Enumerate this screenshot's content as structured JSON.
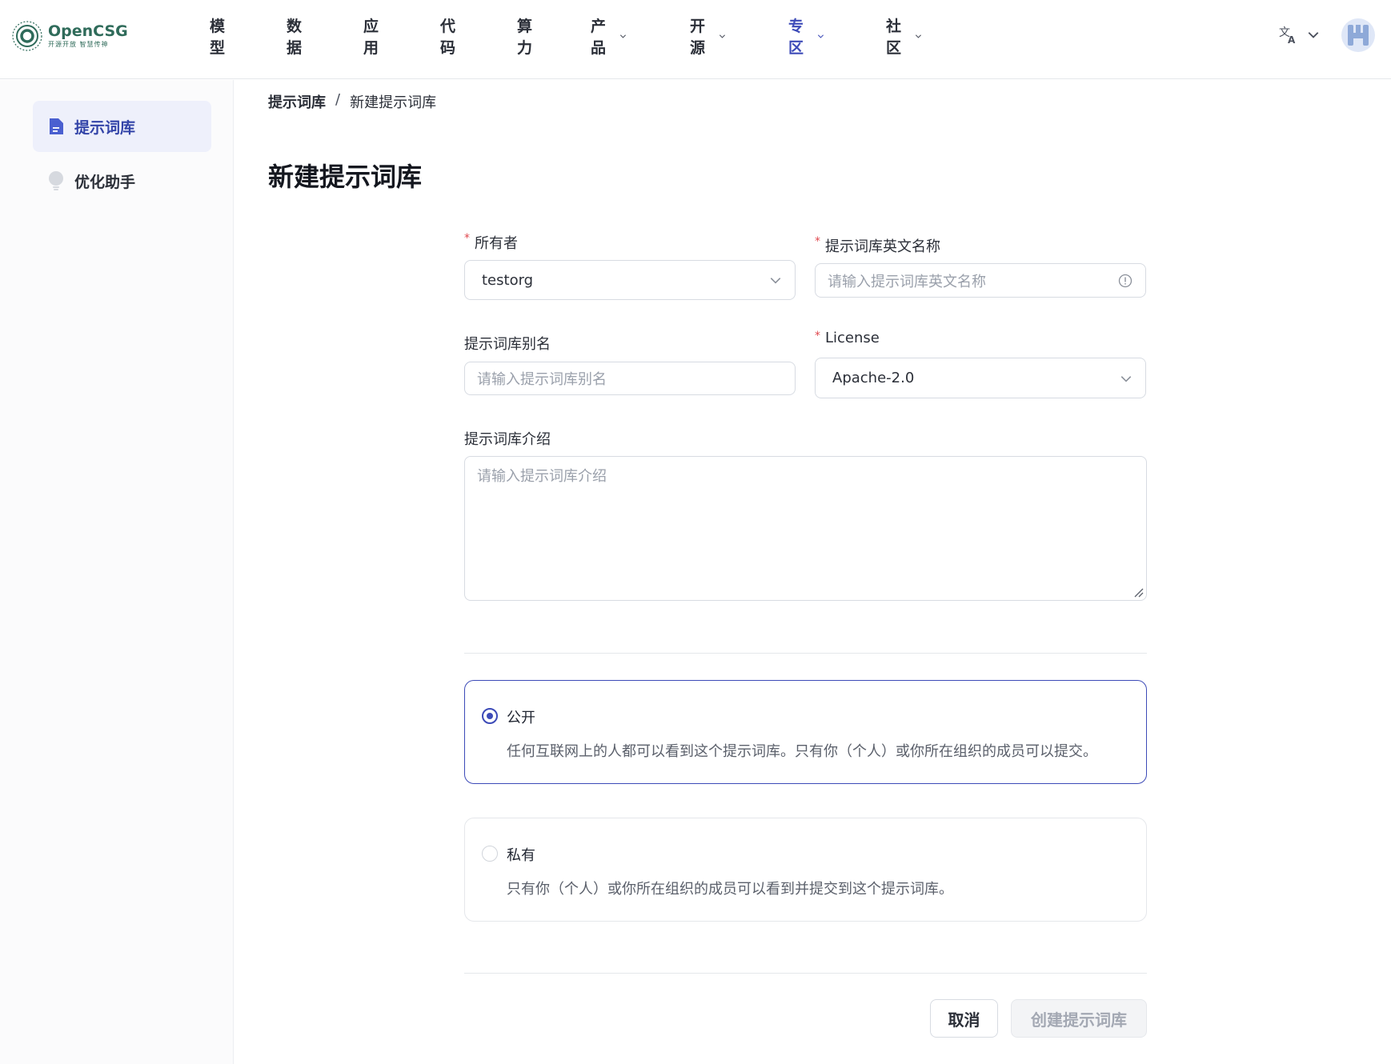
{
  "header": {
    "logo": {
      "name": "OpenCSG",
      "tagline": "开源开放 智慧传神"
    },
    "nav": [
      {
        "label": "模型",
        "has_dropdown": false
      },
      {
        "label": "数据",
        "has_dropdown": false
      },
      {
        "label": "应用",
        "has_dropdown": false
      },
      {
        "label": "代码",
        "has_dropdown": false
      },
      {
        "label": "算力",
        "has_dropdown": false
      },
      {
        "label": "产品",
        "has_dropdown": true
      },
      {
        "label": "开源",
        "has_dropdown": true
      },
      {
        "label": "专区",
        "has_dropdown": true
      },
      {
        "label": "社区",
        "has_dropdown": true
      }
    ],
    "active_nav": "专区",
    "lang_icon": "translate-icon"
  },
  "sidebar": {
    "items": [
      {
        "label": "提示词库",
        "icon": "document-icon",
        "active": true
      },
      {
        "label": "优化助手",
        "icon": "lightbulb-icon",
        "active": false
      }
    ]
  },
  "breadcrumb": {
    "root": "提示词库",
    "separator": "/",
    "current": "新建提示词库"
  },
  "page_title": "新建提示词库",
  "form": {
    "owner": {
      "label": "所有者",
      "value": "testorg"
    },
    "english_name": {
      "label": "提示词库英文名称",
      "placeholder": "请输入提示词库英文名称"
    },
    "alias": {
      "label": "提示词库别名",
      "placeholder": "请输入提示词库别名"
    },
    "license": {
      "label": "License",
      "value": "Apache-2.0"
    },
    "description": {
      "label": "提示词库介绍",
      "placeholder": "请输入提示词库介绍"
    },
    "visibility": {
      "selected": "public",
      "public": {
        "title": "公开",
        "desc": "任何互联网上的人都可以看到这个提示词库。只有你（个人）或你所在组织的成员可以提交。"
      },
      "private": {
        "title": "私有",
        "desc": "只有你（个人）或你所在组织的成员可以看到并提交到这个提示词库。"
      }
    },
    "buttons": {
      "cancel": "取消",
      "create": "创建提示词库"
    }
  },
  "colors": {
    "accent": "#3d4bb8",
    "required": "#e0484e",
    "brand": "#2f6b5a"
  }
}
